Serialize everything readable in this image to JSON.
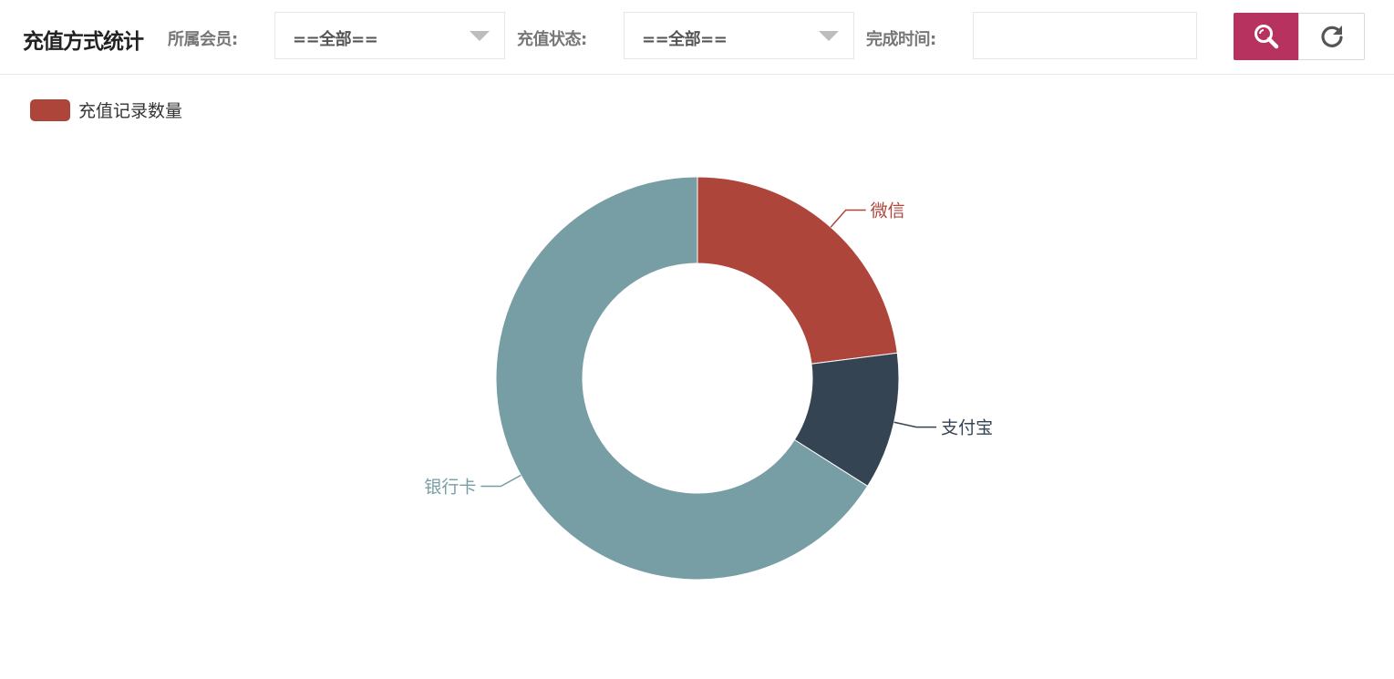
{
  "header": {
    "title": "充值方式统计",
    "member_label": "所属会员:",
    "member_value": "==全部==",
    "status_label": "充值状态:",
    "status_value": "==全部==",
    "time_label": "完成时间:",
    "time_value": "",
    "search_icon": "search-icon",
    "reset_icon": "refresh-icon"
  },
  "chart_data": {
    "type": "pie",
    "legend": [
      {
        "name": "充值记录数量",
        "color": "#ad453a"
      }
    ],
    "legend_placement": "top-left",
    "donut": true,
    "slices": [
      {
        "label": "微信",
        "value": 23,
        "color": "#ad453a"
      },
      {
        "label": "支付宝",
        "value": 11,
        "color": "#344453"
      },
      {
        "label": "银行卡",
        "value": 66,
        "color": "#779ea5"
      }
    ]
  }
}
